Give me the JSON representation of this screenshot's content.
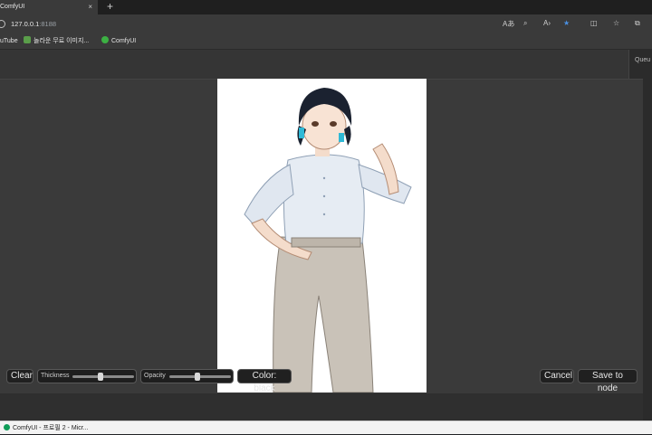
{
  "browser": {
    "tab_title": "ComfyUI",
    "tab_close": "×",
    "new_tab": "+",
    "url_host": "127.0.0.1",
    "url_port": ":8188",
    "toolbar_icons": [
      "read-aloud-icon",
      "zoom-icon",
      "text-size-icon",
      "favorite-star-icon",
      "split-screen-icon",
      "favorites-icon",
      "collections-icon"
    ],
    "accent": "#4a90e2"
  },
  "bookmarks": [
    {
      "label": "uTube"
    },
    {
      "label": "놀라운 무료 이미지..."
    },
    {
      "label": "ComfyUI"
    }
  ],
  "side_panel": {
    "label": "Queu"
  },
  "mask_editor": {
    "clear": "Clear",
    "thickness_label": "Thickness",
    "thickness_value": 0.45,
    "opacity_label": "Opacity",
    "opacity_value": 0.45,
    "color_button": "Color: black",
    "cancel": "Cancel",
    "save": "Save to node"
  },
  "taskbar": {
    "item": "ComfyUI - 프로필 2 - Micr..."
  }
}
